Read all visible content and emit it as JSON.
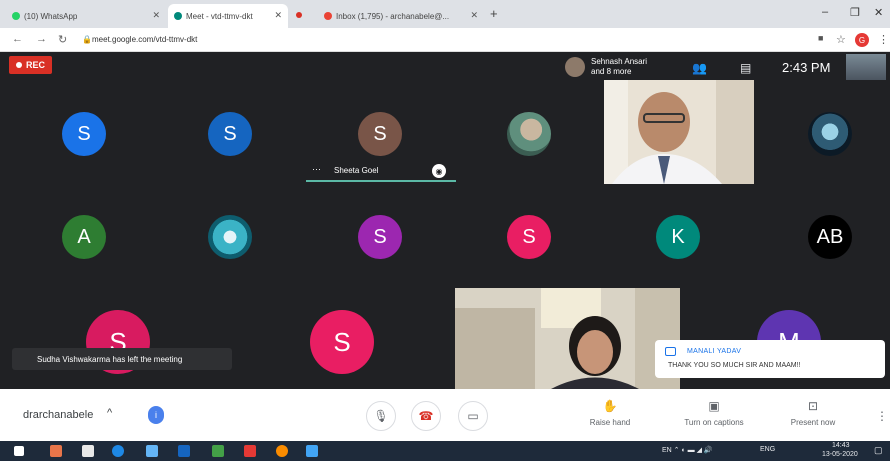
{
  "browser": {
    "tabs": [
      {
        "label": "(10) WhatsApp",
        "color": "#25d366"
      },
      {
        "label": "Meet - vtd-ttmv-dkt",
        "color": "#00897b"
      },
      {
        "label": "Inbox (1,795) - archanabele@...",
        "color": "#ea4335"
      }
    ],
    "new_tab": "+",
    "url": "meet.google.com/vtd-ttmv-dkt",
    "profile_initial": "G"
  },
  "meet": {
    "rec_label": "REC",
    "presenter": {
      "name": "Sehnash Ansari",
      "more": "and 8 more"
    },
    "time": "2:43 PM",
    "speaker_name": "Sheeta Goel",
    "toast": "Sudha Vishwakarma has left the meeting",
    "chat": {
      "sender": "MANALI YADAV",
      "message": "THANK YOU SO MUCH SIR AND MAAM!!"
    },
    "participants": [
      {
        "letter": "S",
        "color": "#1a73e8"
      },
      {
        "letter": "S",
        "color": "#1565c0"
      },
      {
        "letter": "S",
        "color": "#795548"
      },
      {
        "letter": "A",
        "color": "#2e7d32"
      },
      {
        "letter": "S",
        "color": "#9c27b0"
      },
      {
        "letter": "S",
        "color": "#e91e63"
      },
      {
        "letter": "K",
        "color": "#00897b"
      },
      {
        "letter": "AB",
        "color": "#000000"
      },
      {
        "letter": "S",
        "color": "#d81b60"
      },
      {
        "letter": "S",
        "color": "#e91e63"
      },
      {
        "letter": "M",
        "color": "#5e35b1"
      }
    ]
  },
  "controls": {
    "meeting_name": "drarchanabele",
    "raise_hand": "Raise hand",
    "captions": "Turn on captions",
    "present": "Present now"
  },
  "taskbar": {
    "lang": "ENG",
    "time": "14:43",
    "date": "13-05-2020"
  }
}
